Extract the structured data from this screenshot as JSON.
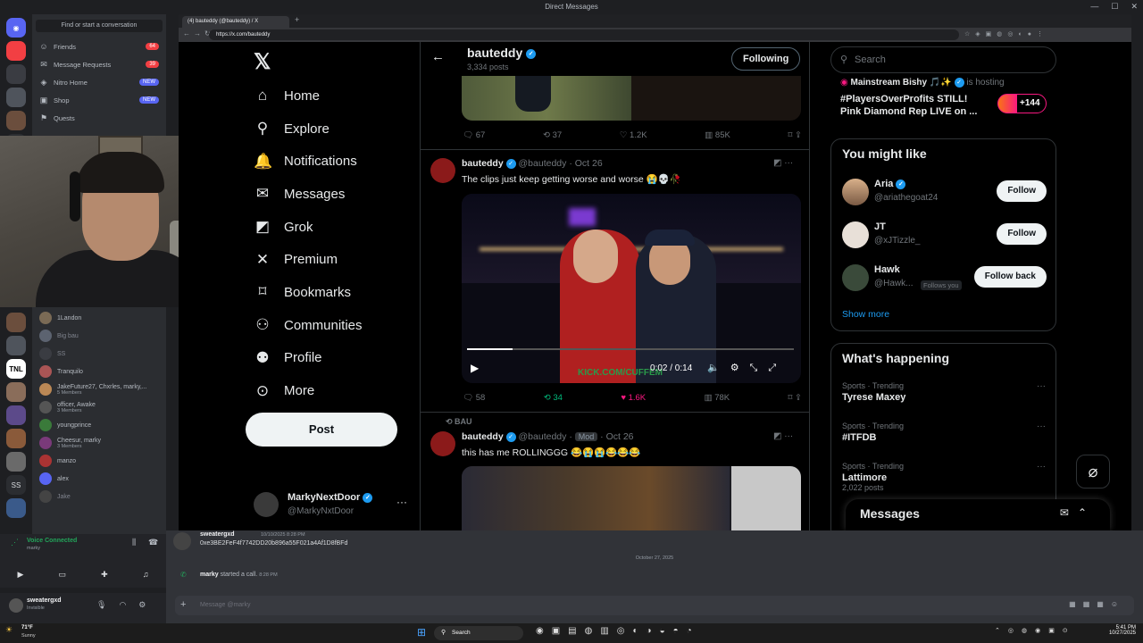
{
  "discord": {
    "window_title": "Direct Messages",
    "search_placeholder": "Find or start a conversation",
    "nav": [
      {
        "label": "Friends",
        "badge": "64"
      },
      {
        "label": "Message Requests",
        "badge": "39"
      },
      {
        "label": "Nitro Home",
        "badge": "NEW"
      },
      {
        "label": "Shop",
        "badge": "NEW"
      },
      {
        "label": "Quests",
        "badge": ""
      }
    ],
    "dms": [
      {
        "name": "1Landon",
        "sub": ""
      },
      {
        "name": "Big bau",
        "sub": ""
      },
      {
        "name": "SS",
        "sub": ""
      },
      {
        "name": "Tranquilo",
        "sub": ""
      },
      {
        "name": "JakeFuture27, Chxrles, marky,...",
        "sub": "5 Members"
      },
      {
        "name": "officer, Awake",
        "sub": "3 Members"
      },
      {
        "name": "youngprince",
        "sub": ""
      },
      {
        "name": "Cheesur, marky",
        "sub": "3 Members"
      },
      {
        "name": "manzo",
        "sub": ""
      },
      {
        "name": "alex",
        "sub": ""
      },
      {
        "name": "Jake",
        "sub": ""
      }
    ],
    "voice": {
      "status": "Voice Connected",
      "channel": "marky"
    },
    "user": {
      "name": "sweatergxd",
      "status": "Invisible"
    },
    "chat": {
      "msg_user": "sweatergxd",
      "msg_meta": "10/10/2025 8:28 PM",
      "msg_text": "0xe3BE2FeF4f7742DD20b896a55F021a4Af1D8fBFd",
      "date_divider": "October 27, 2025",
      "call_user": "marky",
      "call_text": "started a call.",
      "call_time": "8:28 PM",
      "input_placeholder": "Message @marky"
    }
  },
  "browser": {
    "tab_title": "(4) bauteddy (@bauteddy) / X",
    "url": "https://x.com/bauteddy"
  },
  "x": {
    "nav": [
      {
        "label": "Home",
        "icon": "home-icon"
      },
      {
        "label": "Explore",
        "icon": "search-icon"
      },
      {
        "label": "Notifications",
        "icon": "bell-icon"
      },
      {
        "label": "Messages",
        "icon": "mail-icon"
      },
      {
        "label": "Grok",
        "icon": "grok-icon"
      },
      {
        "label": "Premium",
        "icon": "x-icon"
      },
      {
        "label": "Bookmarks",
        "icon": "bookmark-icon"
      },
      {
        "label": "Communities",
        "icon": "people-icon"
      },
      {
        "label": "Profile",
        "icon": "person-icon"
      },
      {
        "label": "More",
        "icon": "more-icon"
      }
    ],
    "post_label": "Post",
    "account": {
      "name": "MarkyNextDoor",
      "handle": "@MarkyNxtDoor"
    },
    "profile": {
      "name": "bauteddy",
      "posts": "3,334 posts",
      "following_label": "Following"
    },
    "tweet0_stats": {
      "replies": "67",
      "reposts": "37",
      "likes": "1.2K",
      "views": "85K"
    },
    "tweet1": {
      "name": "bauteddy",
      "handle": "@bauteddy",
      "date": "Oct 26",
      "text": "The clips just keep getting worse and worse 😭💀🥀",
      "video_time": "0:02 / 0:14",
      "video_watermark": "KICK.COM/CUFFEM",
      "replies": "58",
      "reposts": "34",
      "likes": "1.6K",
      "views": "78K"
    },
    "tweet2": {
      "repost_by": "BAU",
      "name": "bauteddy",
      "handle": "@bauteddy",
      "badge": "Mod",
      "date": "Oct 26",
      "text": "this has me ROLLINGGG 😂😭😭😂😂😂"
    },
    "search_placeholder": "Search",
    "live": {
      "host": "Mainstream Bishy 🎵✨",
      "hosting": "is hosting",
      "title": "#PlayersOverProfits STILL! Pink Diamond Rep LIVE on ...",
      "count": "+144"
    },
    "you_might_like": {
      "title": "You might like",
      "people": [
        {
          "name": "Aria",
          "handle": "@ariathegoat24",
          "button": "Follow",
          "follows_you": ""
        },
        {
          "name": "JT",
          "handle": "@xJTizzle_",
          "button": "Follow",
          "follows_you": ""
        },
        {
          "name": "Hawk",
          "handle": "@Hawk...",
          "button": "Follow back",
          "follows_you": "Follows you"
        }
      ],
      "show_more": "Show more"
    },
    "happening": {
      "title": "What's happening",
      "trends": [
        {
          "cat": "Sports · Trending",
          "name": "Tyrese Maxey",
          "posts": ""
        },
        {
          "cat": "Sports · Trending",
          "name": "#ITFDB",
          "posts": ""
        },
        {
          "cat": "Sports · Trending",
          "name": "Lattimore",
          "posts": "2,022 posts"
        }
      ]
    },
    "messages_drawer": "Messages"
  },
  "taskbar": {
    "weather_temp": "71°F",
    "weather_desc": "Sunny",
    "search_label": "Search",
    "time": "5:41 PM",
    "date": "10/27/2025"
  },
  "colors": {
    "x_blue": "#1d9bf0",
    "like_pink": "#f91880",
    "repost_green": "#00ba7c",
    "discord_blurple": "#5865f2"
  }
}
